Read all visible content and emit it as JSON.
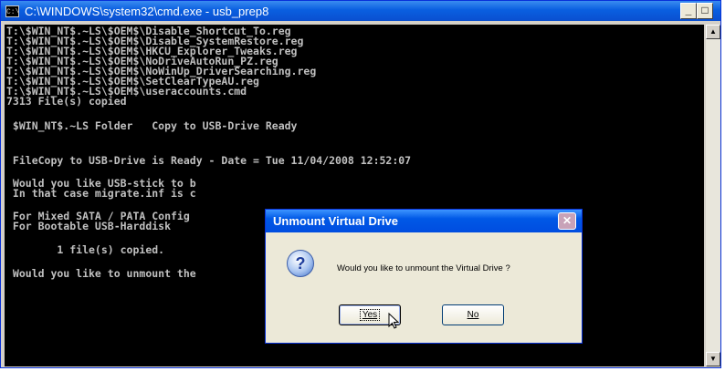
{
  "window": {
    "title": "C:\\WINDOWS\\system32\\cmd.exe - usb_prep8",
    "icon_text": "C:\\",
    "minimize_label": "_",
    "maximize_label": "□"
  },
  "console": {
    "lines": [
      "T:\\$WIN_NT$.~LS\\$OEM$\\Disable_Shortcut_To.reg",
      "T:\\$WIN_NT$.~LS\\$OEM$\\Disable_SystemRestore.reg",
      "T:\\$WIN_NT$.~LS\\$OEM$\\HKCU_Explorer_Tweaks.reg",
      "T:\\$WIN_NT$.~LS\\$OEM$\\NoDriveAutoRun_PZ.reg",
      "T:\\$WIN_NT$.~LS\\$OEM$\\NoWinUp_DriverSearching.reg",
      "T:\\$WIN_NT$.~LS\\$OEM$\\SetClearTypeAU.reg",
      "T:\\$WIN_NT$.~LS\\$OEM$\\useraccounts.cmd",
      "7313 File(s) copied",
      " $WIN_NT$.~LS Folder   Copy to USB-Drive Ready",
      " FileCopy to USB-Drive is Ready - Date = Tue 11/04/2008 12:52:07",
      " Would you like USB-stick to b",
      " In that case migrate.inf is c",
      " For Mixed SATA / PATA Config",
      " For Bootable USB-Harddisk",
      "        1 file(s) copied.",
      " Would you like to unmount the"
    ]
  },
  "scrollbar": {
    "up_icon": "scroll-up-arrow",
    "down_icon": "scroll-down-arrow"
  },
  "dialog": {
    "title": "Unmount Virtual Drive",
    "close_label": "✕",
    "icon": "question-icon",
    "message": "Would you like to unmount the Virtual Drive ?",
    "yes_label": "Yes",
    "no_label": "No"
  }
}
